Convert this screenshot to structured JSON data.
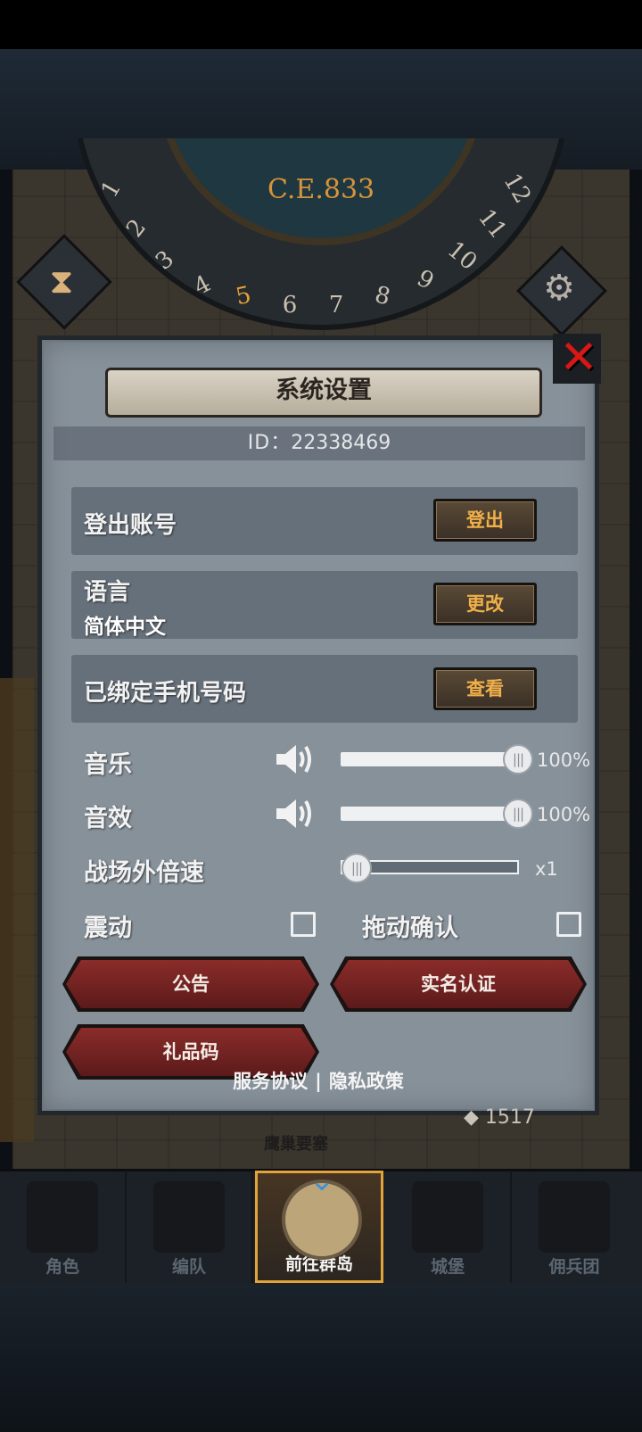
{
  "header": {
    "era": "C.E.833",
    "clock_numbers": [
      "1",
      "2",
      "3",
      "4",
      "5",
      "6",
      "7",
      "8",
      "9",
      "10",
      "11",
      "12"
    ],
    "current_hour": "5"
  },
  "dialog": {
    "title": "系统设置",
    "id_label": "ID：",
    "id_value": "22338469",
    "rows": {
      "logout": {
        "label": "登出账号",
        "button": "登出"
      },
      "language": {
        "label": "语言",
        "value": "简体中文",
        "button": "更改"
      },
      "phone": {
        "label": "已绑定手机号码",
        "button": "查看"
      }
    },
    "music": {
      "label": "音乐",
      "percent": "100%",
      "value": 1.0
    },
    "sfx": {
      "label": "音效",
      "percent": "100%",
      "value": 1.0
    },
    "speed": {
      "label": "战场外倍速",
      "value_text": "x1",
      "value": 0.0
    },
    "vibrate": {
      "label": "震动",
      "checked": false
    },
    "drag_confirm": {
      "label": "拖动确认",
      "checked": false
    },
    "buttons": {
      "announcement": "公告",
      "realname": "实名认证",
      "giftcode": "礼品码"
    },
    "links": {
      "terms": "服务协议",
      "separator": "|",
      "privacy": "隐私政策"
    }
  },
  "background": {
    "resource_count": "1517",
    "behind_label": "鹰巢要塞"
  },
  "nav": {
    "items": [
      {
        "label": "角色"
      },
      {
        "label": "编队"
      },
      {
        "label": "前往群岛"
      },
      {
        "label": "城堡"
      },
      {
        "label": "佣兵团"
      }
    ],
    "active_index": 2
  },
  "colors": {
    "accent_gold": "#e2a33a",
    "close_red": "#d81717",
    "button_red": "#8a2c2a",
    "panel_gray": "#87919a"
  }
}
